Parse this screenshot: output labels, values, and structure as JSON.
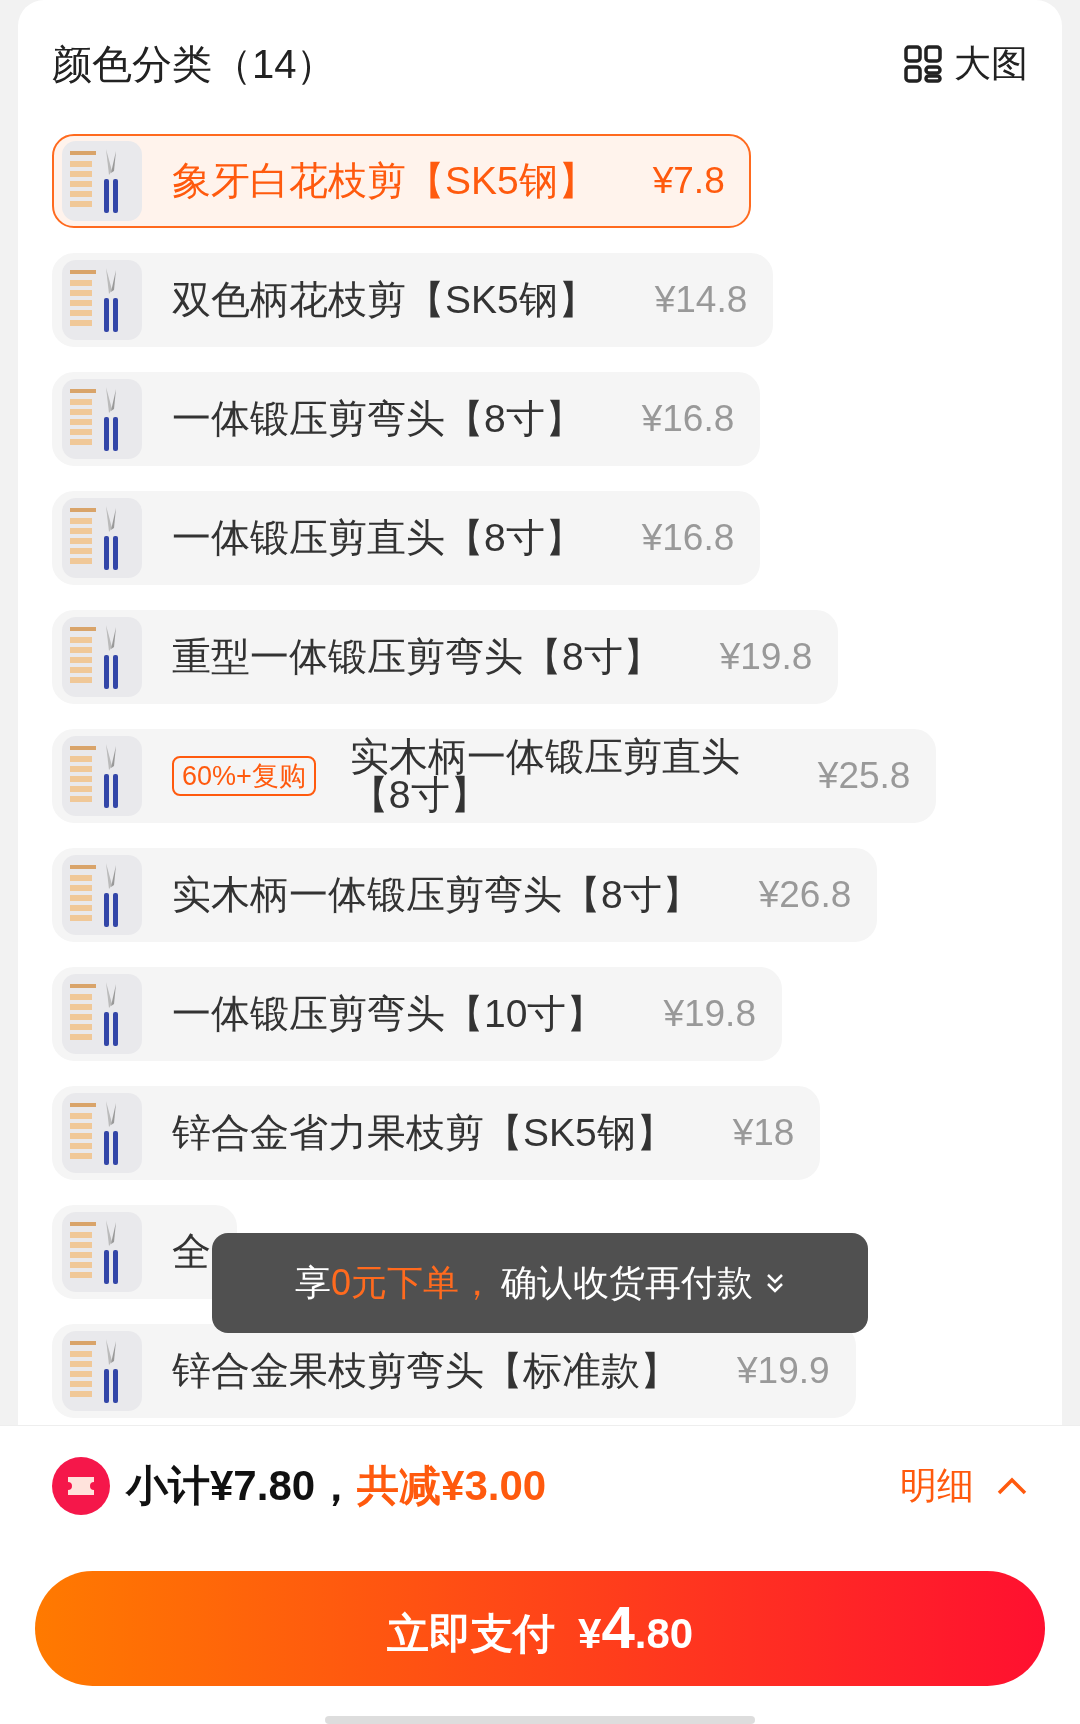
{
  "header": {
    "title": "颜色分类（14）",
    "view_toggle": "大图"
  },
  "items": [
    {
      "name": "象牙白花枝剪【SK5钢】",
      "price": "¥7.8",
      "selected": true
    },
    {
      "name": "双色柄花枝剪【SK5钢】",
      "price": "¥14.8",
      "selected": false
    },
    {
      "name": "一体锻压剪弯头【8寸】",
      "price": "¥16.8",
      "selected": false
    },
    {
      "name": "一体锻压剪直头【8寸】",
      "price": "¥16.8",
      "selected": false
    },
    {
      "name": "重型一体锻压剪弯头【8寸】",
      "price": "¥19.8",
      "selected": false
    },
    {
      "name": "实木柄一体锻压剪直头【8寸】",
      "price": "¥25.8",
      "selected": false,
      "badge": "60%+复购"
    },
    {
      "name": "实木柄一体锻压剪弯头【8寸】",
      "price": "¥26.8",
      "selected": false
    },
    {
      "name": "一体锻压剪弯头【10寸】",
      "price": "¥19.8",
      "selected": false
    },
    {
      "name": "锌合金省力果枝剪【SK5钢】",
      "price": "¥18",
      "selected": false
    },
    {
      "name": "全",
      "selected": false
    },
    {
      "name": "锌合金果枝剪弯头【标准款】",
      "price": "¥19.9",
      "selected": false
    }
  ],
  "toast": {
    "prefix": "享",
    "highlight": "0元下单，",
    "rest": "确认收货再付款"
  },
  "summary": {
    "subtotal": "小计¥7.80，",
    "discount": "共减¥3.00",
    "details": "明细"
  },
  "pay_button": {
    "label": "立即支付",
    "currency": "¥",
    "integer": "4",
    "decimal": ".80"
  }
}
